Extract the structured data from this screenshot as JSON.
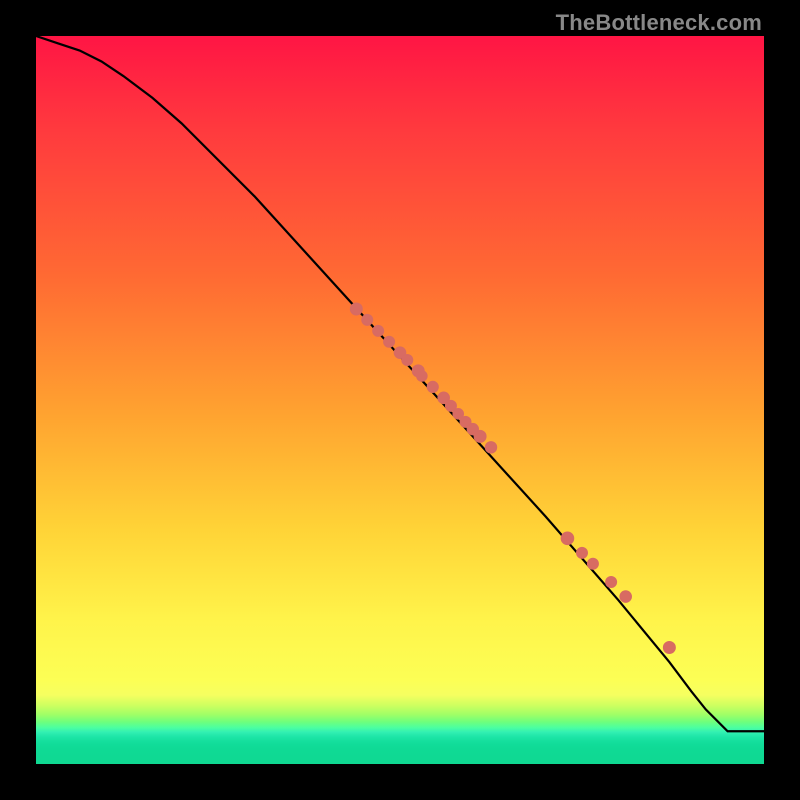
{
  "watermark": "TheBottleneck.com",
  "colors": {
    "dot": "#d86b62",
    "line": "#000000"
  },
  "chart_data": {
    "type": "line",
    "title": "",
    "xlabel": "",
    "ylabel": "",
    "xlim": [
      0,
      100
    ],
    "ylim": [
      0,
      100
    ],
    "note": "Axes are unlabeled; x and y are normalized 0–100 across the plot area (origin bottom-left).",
    "series": [
      {
        "name": "curve",
        "type": "line",
        "x": [
          0,
          3,
          6,
          9,
          12,
          16,
          20,
          30,
          40,
          50,
          60,
          70,
          80,
          87,
          90,
          92,
          95,
          100
        ],
        "y": [
          100,
          99,
          98,
          96.5,
          94.5,
          91.5,
          88,
          78,
          67,
          56,
          45,
          34,
          22.5,
          14,
          10,
          7.5,
          4.5,
          4.5
        ]
      },
      {
        "name": "markers",
        "type": "scatter",
        "x": [
          44,
          45.5,
          47,
          48.5,
          50,
          51,
          52.5,
          53,
          54.5,
          56,
          57,
          58,
          59,
          60,
          61,
          62.5,
          73,
          75,
          76.5,
          79,
          81,
          87
        ],
        "y": [
          62.5,
          61,
          59.5,
          58,
          56.5,
          55.5,
          54,
          53.3,
          51.8,
          50.3,
          49.2,
          48.1,
          47,
          46,
          45,
          43.5,
          31,
          29,
          27.5,
          25,
          23,
          16
        ],
        "r": [
          6,
          5.5,
          5.5,
          5.5,
          5.8,
          5.5,
          6,
          5.3,
          5.6,
          5.8,
          5.5,
          5.3,
          5.5,
          5.7,
          6,
          5.7,
          6.3,
          5.5,
          5.5,
          5.5,
          5.8,
          6
        ]
      }
    ]
  }
}
